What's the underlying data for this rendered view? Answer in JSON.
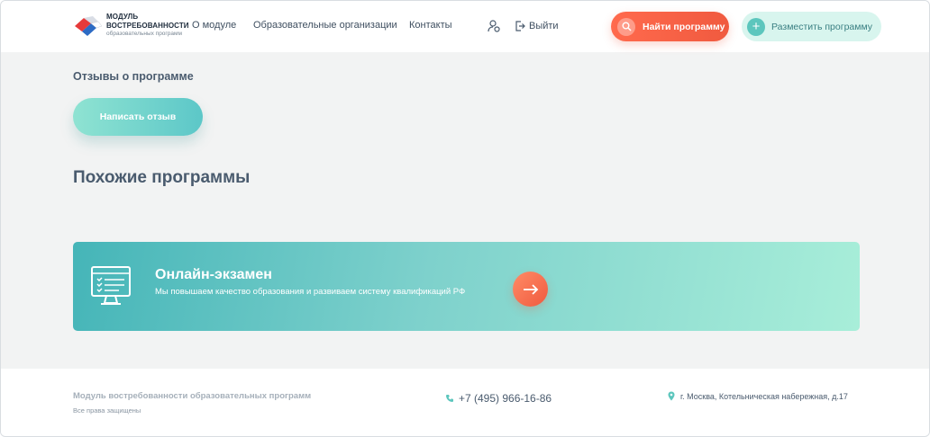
{
  "header": {
    "logo": {
      "line1": "МОДУЛЬ",
      "line2": "ВОСТРЕБОВАННОСТИ",
      "line3": "образовательных программ"
    },
    "nav": {
      "about": "О модуле",
      "orgs": "Образовательные организации",
      "contacts": "Контакты",
      "logout": "Выйти"
    },
    "find_button": "Найти программу",
    "place_button": "Разместить программу"
  },
  "main": {
    "reviews_title": "Отзывы о программе",
    "write_review_button": "Написать отзыв",
    "similar_title": "Похожие программы",
    "banner": {
      "title": "Онлайн-экзамен",
      "subtitle": "Мы повышаем качество образования и развиваем систему квалификаций РФ"
    }
  },
  "footer": {
    "name": "Модуль востребованности образовательных программ",
    "rights": "Все права защищены",
    "phone": "+7 (495) 966-16-86",
    "address": "г. Москва, Котельническая набережная, д.17"
  },
  "colors": {
    "accent_orange": "#f05a3f",
    "accent_teal": "#5cc6bd",
    "text": "#4a5b6e"
  }
}
